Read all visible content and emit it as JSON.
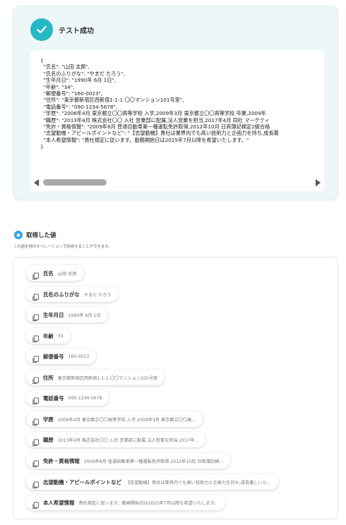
{
  "result": {
    "title": "テスト成功",
    "code_lines": [
      "{",
      "  \"氏名\": \"山田 太郎\",",
      "  \"氏名のふりがな\": \"やまだ たろう\",",
      "  \"生年月日\": \"1990年 6月 1日\",",
      "  \"年齢\": \"34\",",
      "  \"郵便番号\": \"160-0023\",",
      "  \"住所\": \"東京都新宿区西新宿1-1-1 〇〇マンション101号室\",",
      "  \"電話番号\": \"090-1234-5678\",",
      "  \"学歴\": \"2006年4月 東京都立〇〇高等学校 入学,2009年3月 東京都立〇〇高等学校 卒業,2009年",
      "  \"職歴\": \"2013年4月 株式会社〇〇 入社 営業部に配属,法人営業を担当,2017年4月 同社 マーケティ",
      "  \"免許・資格情報\": \"2009年8月 普通自動車第一種運転免許取得,2012年10月 日商簿記検定2級合格",
      "  \"志望動機・アピールポイントなど\": \"【志望動機】貴社は業界内でも高い技術力と企画力を持ち,成長著",
      "  \"本人希望情報\": \"貴社規定に従います。勤務開始日は2025年7月以降を希望いたします。\"",
      "}"
    ]
  },
  "values": {
    "title": "取得した値",
    "description": "この値を他のオペレーションで利用することができます。",
    "items": [
      {
        "label": "氏名",
        "value": "山田 太郎"
      },
      {
        "label": "氏名のふりがな",
        "value": "やまだ たろう"
      },
      {
        "label": "生年月日",
        "value": "1990年 6月 1日"
      },
      {
        "label": "年齢",
        "value": "34"
      },
      {
        "label": "郵便番号",
        "value": "160-0023"
      },
      {
        "label": "住所",
        "value": "東京都新宿区西新宿1-1-1 〇〇マンション101号室"
      },
      {
        "label": "電話番号",
        "value": "090-1234-5678"
      },
      {
        "label": "学歴",
        "value": "2006年4月 東京都立〇〇高等学校 入学,2009年3月 東京都立〇〇高..."
      },
      {
        "label": "職歴",
        "value": "2013年4月 株式会社〇〇 入社 営業部に配属,法人営業を担当,2017年..."
      },
      {
        "label": "免許・資格情報",
        "value": "2009年8月 普通自動車第一種運転免許取得,2012年10月 日商簿記検..."
      },
      {
        "label": "志望動機・アピールポイントなど",
        "value": "【志望動機】貴社は業界内でも高い技術力と企画力を持ち,成長著しいと..."
      },
      {
        "label": "本人希望情報",
        "value": "貴社規定に従います。勤務開始日は2025年7月以降を希望いたします。"
      }
    ]
  },
  "colors": {
    "accent": "#26b8c4",
    "badge": "#2fa4e0",
    "card_bg": "#eef7f7"
  },
  "icons": {
    "success": "check-icon",
    "values_header": "star-badge-icon",
    "chip": "copy-icon"
  }
}
